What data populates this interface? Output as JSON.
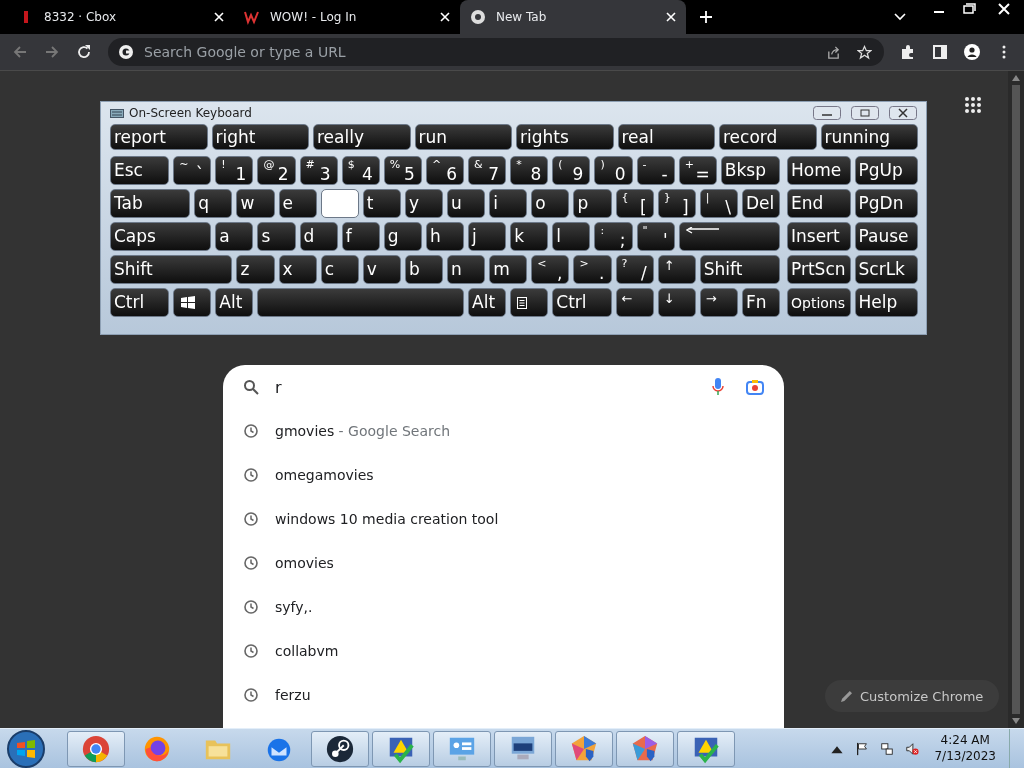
{
  "browser": {
    "tabs": [
      {
        "title": "8332 · Cbox",
        "kind": "cbox",
        "selected": false
      },
      {
        "title": "WOW! - Log In",
        "kind": "wow",
        "selected": false
      },
      {
        "title": "New Tab",
        "kind": "chrome",
        "selected": true
      }
    ],
    "omnibox": {
      "placeholder": "Search Google or type a URL"
    }
  },
  "keyboard": {
    "title": "On-Screen Keyboard",
    "predictions": [
      "report",
      "right",
      "really",
      "run",
      "rights",
      "real",
      "record",
      "running"
    ],
    "main_rows": [
      [
        {
          "kind": "word",
          "label": "Esc"
        },
        {
          "kind": "dual",
          "shift": "~",
          "label": "`"
        },
        {
          "kind": "dual",
          "shift": "!",
          "label": "1"
        },
        {
          "kind": "dual",
          "shift": "@",
          "label": "2"
        },
        {
          "kind": "dual",
          "shift": "#",
          "label": "3"
        },
        {
          "kind": "dual",
          "shift": "$",
          "label": "4"
        },
        {
          "kind": "dual",
          "shift": "%",
          "label": "5"
        },
        {
          "kind": "dual",
          "shift": "^",
          "label": "6"
        },
        {
          "kind": "dual",
          "shift": "&",
          "label": "7"
        },
        {
          "kind": "dual",
          "shift": "*",
          "label": "8"
        },
        {
          "kind": "dual",
          "shift": "(",
          "label": "9"
        },
        {
          "kind": "dual",
          "shift": ")",
          "label": "0"
        },
        {
          "kind": "dual",
          "shift": "-",
          "label": "-"
        },
        {
          "kind": "dual",
          "shift": "+",
          "label": "="
        },
        {
          "kind": "word",
          "label": "Bksp"
        }
      ],
      [
        {
          "kind": "word",
          "label": "Tab"
        },
        {
          "kind": "word",
          "label": "q"
        },
        {
          "kind": "word",
          "label": "w"
        },
        {
          "kind": "word",
          "label": "e"
        },
        {
          "kind": "pressed"
        },
        {
          "kind": "word",
          "label": "t"
        },
        {
          "kind": "word",
          "label": "y"
        },
        {
          "kind": "word",
          "label": "u"
        },
        {
          "kind": "word",
          "label": "i"
        },
        {
          "kind": "word",
          "label": "o"
        },
        {
          "kind": "word",
          "label": "p"
        },
        {
          "kind": "dual",
          "shift": "{",
          "label": "["
        },
        {
          "kind": "dual",
          "shift": "}",
          "label": "]"
        },
        {
          "kind": "dual",
          "shift": "|",
          "label": "\\"
        },
        {
          "kind": "word",
          "label": "Del"
        }
      ],
      [
        {
          "kind": "word",
          "label": "Caps"
        },
        {
          "kind": "word",
          "label": "a"
        },
        {
          "kind": "word",
          "label": "s"
        },
        {
          "kind": "word",
          "label": "d"
        },
        {
          "kind": "word",
          "label": "f"
        },
        {
          "kind": "word",
          "label": "g"
        },
        {
          "kind": "word",
          "label": "h"
        },
        {
          "kind": "word",
          "label": "j"
        },
        {
          "kind": "word",
          "label": "k"
        },
        {
          "kind": "word",
          "label": "l"
        },
        {
          "kind": "dual",
          "shift": ":",
          "label": ";"
        },
        {
          "kind": "dual",
          "shift": "\"",
          "label": "'"
        },
        {
          "kind": "enter"
        }
      ],
      [
        {
          "kind": "word",
          "label": "Shift"
        },
        {
          "kind": "word",
          "label": "z"
        },
        {
          "kind": "word",
          "label": "x"
        },
        {
          "kind": "word",
          "label": "c"
        },
        {
          "kind": "word",
          "label": "v"
        },
        {
          "kind": "word",
          "label": "b"
        },
        {
          "kind": "word",
          "label": "n"
        },
        {
          "kind": "word",
          "label": "m"
        },
        {
          "kind": "dual",
          "shift": "<",
          "label": ","
        },
        {
          "kind": "dual",
          "shift": ">",
          "label": "."
        },
        {
          "kind": "dual",
          "shift": "?",
          "label": "/"
        },
        {
          "kind": "arrow",
          "label": "↑"
        },
        {
          "kind": "word",
          "label": "Shift"
        }
      ],
      [
        {
          "kind": "word",
          "label": "Ctrl"
        },
        {
          "kind": "windows"
        },
        {
          "kind": "word",
          "label": "Alt"
        },
        {
          "kind": "space"
        },
        {
          "kind": "word",
          "label": "Alt"
        },
        {
          "kind": "menu"
        },
        {
          "kind": "word",
          "label": "Ctrl"
        },
        {
          "kind": "arrow",
          "label": "←"
        },
        {
          "kind": "arrow",
          "label": "↓"
        },
        {
          "kind": "arrow",
          "label": "→"
        },
        {
          "kind": "word",
          "label": "Fn"
        }
      ]
    ],
    "side_rows": [
      [
        "Home",
        "PgUp"
      ],
      [
        "End",
        "PgDn"
      ],
      [
        "Insert",
        "Pause"
      ],
      [
        "PrtScn",
        "ScrLk"
      ],
      [
        "Options",
        "Help"
      ]
    ]
  },
  "search": {
    "value": "r",
    "suggestions": [
      {
        "text": "gmovies",
        "suffix": " - Google Search"
      },
      {
        "text": "omegamovies"
      },
      {
        "text": "windows 10 media creation tool"
      },
      {
        "text": "omovies"
      },
      {
        "text": "syfy,."
      },
      {
        "text": "collabvm"
      },
      {
        "text": "ferzu"
      }
    ]
  },
  "customize_button": "Customize Chrome",
  "taskbar": {
    "apps": [
      {
        "kind": "chrome",
        "running": true
      },
      {
        "kind": "firefox",
        "running": false
      },
      {
        "kind": "folder",
        "running": false
      },
      {
        "kind": "thunderbird",
        "running": false
      },
      {
        "kind": "steam",
        "running": true
      },
      {
        "kind": "warning",
        "running": true
      },
      {
        "kind": "panel",
        "running": true
      },
      {
        "kind": "keyboard",
        "running": true
      },
      {
        "kind": "shield",
        "running": true
      },
      {
        "kind": "shield2",
        "running": true
      },
      {
        "kind": "warning",
        "running": true
      }
    ],
    "time": "4:24 AM",
    "date": "7/13/2023"
  }
}
